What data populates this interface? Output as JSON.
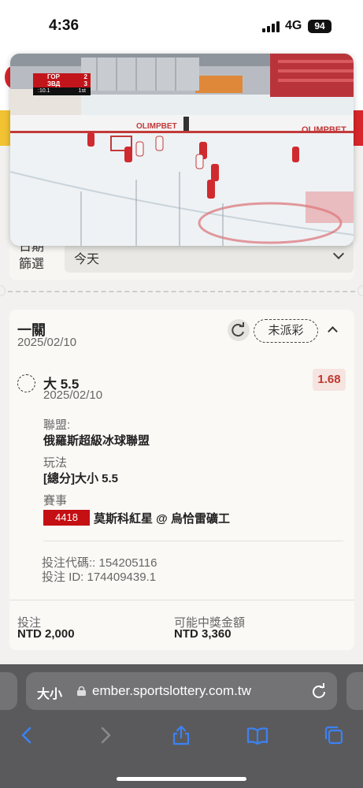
{
  "status_bar": {
    "time": "4:36",
    "network": "4G",
    "battery": "94"
  },
  "filter": {
    "date_label": "日期篩選",
    "date_value": "今天"
  },
  "video": {
    "scoreboard": {
      "team1": "ГОР",
      "score1": "2",
      "team2": "ЗВД",
      "score2": "3",
      "clock": ":10.1",
      "period": "1st"
    },
    "board_ad": "OLIMPBET"
  },
  "bet": {
    "title": "一關",
    "date": "2025/02/10",
    "status": "未派彩",
    "selection": {
      "name": "大 5.5",
      "date": "2025/02/10",
      "odds": "1.68"
    },
    "league_label": "聯盟:",
    "league": "俄羅斯超級冰球聯盟",
    "market_label": "玩法",
    "market": "[總分]大小 5.5",
    "event_label": "賽事",
    "match_id": "4418",
    "match": "莫斯科紅星 @ 烏恰雷礦工",
    "bet_code": "投注代碼:: 154205116",
    "bet_id": "投注 ID: 174409439.1",
    "stake_label": "投注",
    "stake": "NTD 2,000",
    "payout_label": "可能中獎金額",
    "payout": "NTD 3,360"
  },
  "browser": {
    "text_size_label": "大小",
    "url": "ember.sportslottery.com.tw"
  },
  "colors": {
    "accent_red": "#c40f13",
    "odds_red": "#c0392b",
    "safari_gray": "#5a5a5c"
  }
}
